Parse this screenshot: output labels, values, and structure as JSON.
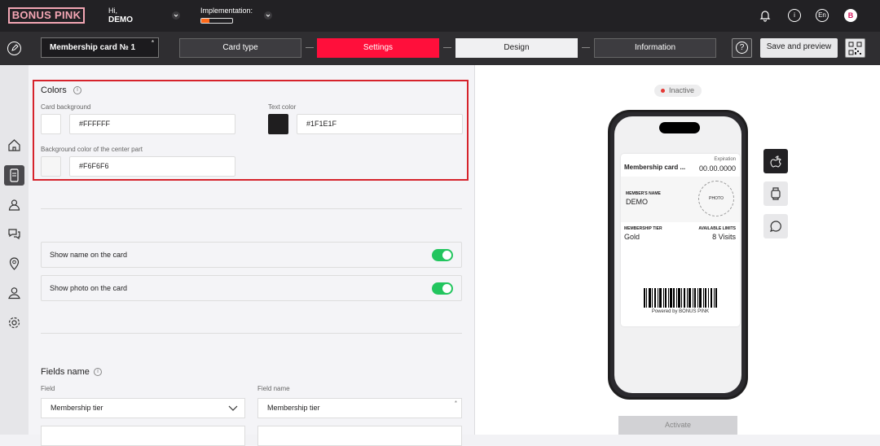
{
  "topbar": {
    "logo": "BONUS PINK",
    "greeting": "Hi,",
    "user": "DEMO",
    "implementation_label": "Implementation:",
    "implementation_progress": 0.27,
    "language": "En",
    "avatar_letter": "B"
  },
  "subbar": {
    "card_name": "Membership card № 1",
    "required_mark": "*",
    "steps": [
      "Card type",
      "Settings",
      "Design",
      "Information"
    ],
    "help": "?",
    "save_label": "Save and preview"
  },
  "colors": {
    "title": "Colors",
    "info": "i",
    "card_bg_label": "Card background",
    "card_bg_value": "#FFFFFF",
    "text_color_label": "Text color",
    "text_color_value": "#1F1E1F",
    "center_bg_label": "Background color of the center part",
    "center_bg_value": "#F6F6F6"
  },
  "toggles": {
    "show_name": "Show name on the card",
    "show_photo": "Show photo on the card"
  },
  "fields": {
    "title": "Fields name",
    "info": "i",
    "col_field": "Field",
    "col_name": "Field name",
    "row1_field": "Membership tier",
    "row1_name": "Membership tier",
    "required_mark": "*"
  },
  "preview": {
    "status": "Inactive",
    "card_title": "Membership card ...",
    "expiration_label": "Expiration",
    "expiration_value": "00.00.0000",
    "member_name_label": "MEMBER'S NAME",
    "member_name": "DEMO",
    "photo": "PHOTO",
    "tier_label": "MEMBERSHIP TIER",
    "tier_value": "Gold",
    "limits_label": "AVAILABLE LIMITS",
    "limits_value": "8 Visits",
    "powered": "Powered by BONUS PINK",
    "activate": "Activate"
  },
  "accent": {
    "red": "#FF0F3B",
    "green": "#22C55E",
    "brand_pink": "#F3A6B4"
  }
}
